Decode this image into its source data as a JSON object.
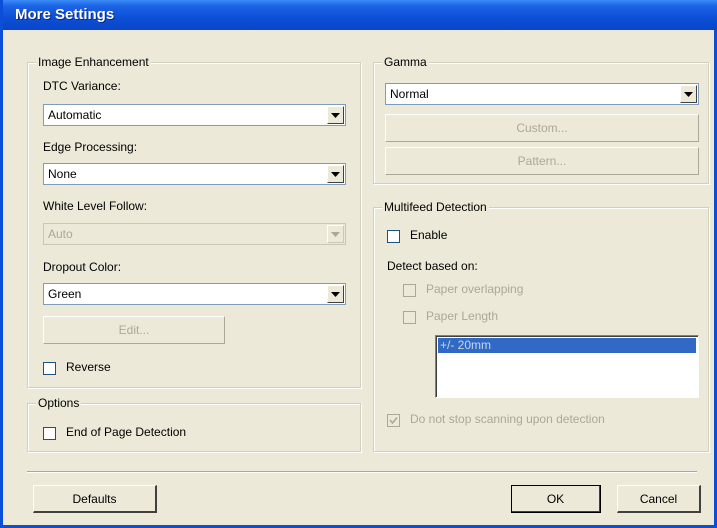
{
  "window": {
    "title": "More Settings"
  },
  "image_enhancement": {
    "legend": "Image Enhancement",
    "dtc_variance": {
      "label": "DTC Variance:",
      "value": "Automatic"
    },
    "edge_processing": {
      "label": "Edge Processing:",
      "value": "None"
    },
    "white_level_follow": {
      "label": "White Level Follow:",
      "value": "Auto"
    },
    "dropout_color": {
      "label": "Dropout Color:",
      "value": "Green"
    },
    "edit_button": "Edit...",
    "reverse": {
      "label": "Reverse",
      "checked": false
    }
  },
  "gamma": {
    "legend": "Gamma",
    "value": "Normal",
    "custom_button": "Custom...",
    "pattern_button": "Pattern..."
  },
  "multifeed": {
    "legend": "Multifeed Detection",
    "enable": {
      "label": "Enable",
      "checked": false
    },
    "detect_label": "Detect based on:",
    "paper_overlapping": {
      "label": "Paper overlapping",
      "checked": false
    },
    "paper_length": {
      "label": "Paper Length",
      "checked": false
    },
    "length_list": [
      "+/- 20mm"
    ],
    "do_not_stop": {
      "label": "Do not stop scanning upon detection",
      "checked": true
    }
  },
  "options": {
    "legend": "Options",
    "end_of_page": {
      "label": "End of Page Detection",
      "checked": false
    }
  },
  "footer": {
    "defaults_button": "Defaults",
    "ok_button": "OK",
    "cancel_button": "Cancel"
  }
}
